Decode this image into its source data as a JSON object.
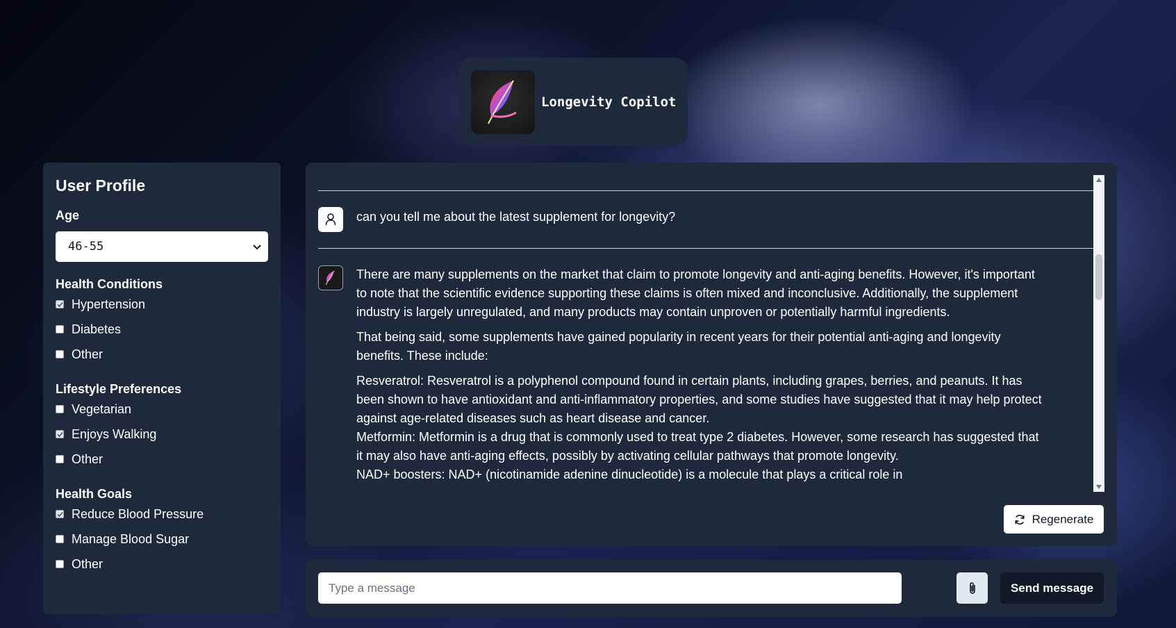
{
  "app": {
    "title": "Longevity Copilot",
    "logo_icon": "feather-icon"
  },
  "sidebar": {
    "title": "User Profile",
    "age": {
      "label": "Age",
      "selected": "46-55"
    },
    "health_conditions": {
      "label": "Health Conditions",
      "items": [
        {
          "label": "Hypertension",
          "checked": true
        },
        {
          "label": "Diabetes",
          "checked": false
        },
        {
          "label": "Other",
          "checked": false
        }
      ]
    },
    "lifestyle": {
      "label": "Lifestyle Preferences",
      "items": [
        {
          "label": "Vegetarian",
          "checked": false
        },
        {
          "label": "Enjoys Walking",
          "checked": true
        },
        {
          "label": "Other",
          "checked": false
        }
      ]
    },
    "goals": {
      "label": "Health Goals",
      "items": [
        {
          "label": "Reduce Blood Pressure",
          "checked": true
        },
        {
          "label": "Manage Blood Sugar",
          "checked": false
        },
        {
          "label": "Other",
          "checked": false
        }
      ]
    }
  },
  "chat": {
    "user_message": "can you tell me about the latest supplement for longevity?",
    "bot_message": {
      "p1": "There are many supplements on the market that claim to promote longevity and anti-aging benefits. However, it's important to note that the scientific evidence supporting these claims is often mixed and inconclusive. Additionally, the supplement industry is largely unregulated, and many products may contain unproven or potentially harmful ingredients.",
      "p2": "That being said, some supplements have gained popularity in recent years for their potential anti-aging and longevity benefits. These include:",
      "item1": "Resveratrol: Resveratrol is a polyphenol compound found in certain plants, including grapes, berries, and peanuts. It has been shown to have antioxidant and anti-inflammatory properties, and some studies have suggested that it may help protect against age-related diseases such as heart disease and cancer.",
      "item2": "Metformin: Metformin is a drug that is commonly used to treat type 2 diabetes. However, some research has suggested that it may also have anti-aging effects, possibly by activating cellular pathways that promote longevity.",
      "item3": "NAD+ boosters: NAD+ (nicotinamide adenine dinucleotide) is a molecule that plays a critical role in"
    },
    "regenerate_label": "Regenerate"
  },
  "composer": {
    "placeholder": "Type a message",
    "value": "",
    "send_label": "Send message",
    "attach_icon": "paperclip-icon"
  },
  "colors": {
    "panel": "#1e293b",
    "send_button": "#111827",
    "text": "#ffffff"
  }
}
